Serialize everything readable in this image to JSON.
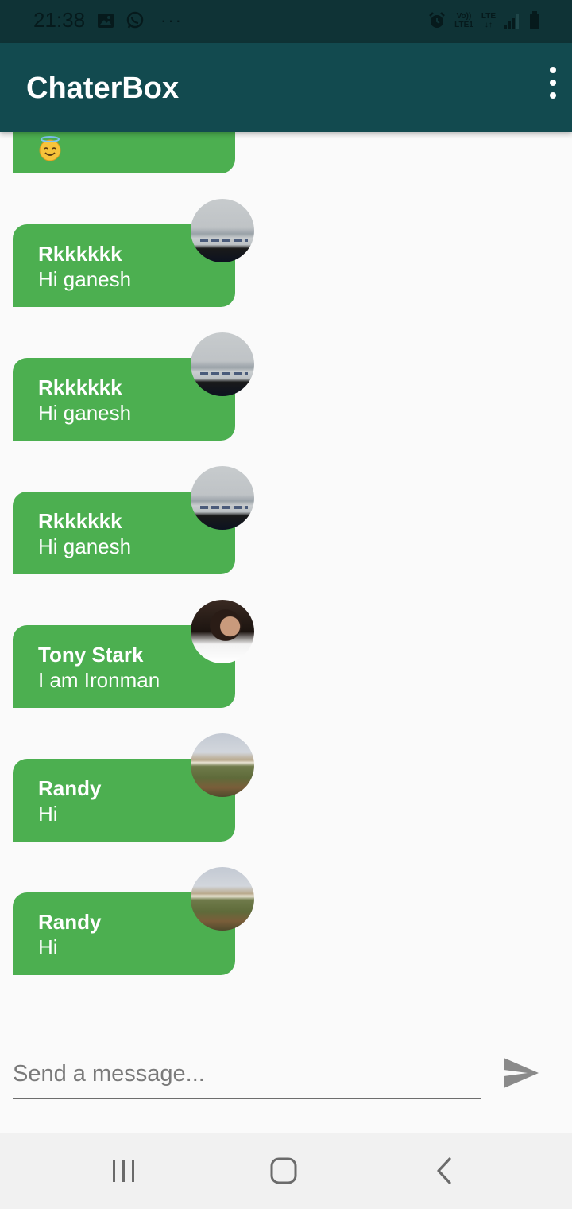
{
  "status_bar": {
    "time": "21:38",
    "left_icons": [
      "image-icon",
      "whatsapp-icon",
      "more-notifications-icon"
    ],
    "overflow_dots": "···",
    "right_icons": [
      "alarm-icon",
      "volte-lte-icon",
      "lte-data-icon",
      "signal-icon",
      "battery-icon"
    ],
    "lte_top": "Vo))",
    "lte_bottom": "LTE1",
    "lte2_top": "LTE",
    "lte2_bottom": "↓↑"
  },
  "app_bar": {
    "title": "ChaterBox",
    "overflow_icon": "more-vert-icon"
  },
  "messages": [
    {
      "sender": "Rkkkkkk",
      "text": "Hi ganesh",
      "avatar": "monitor-photo-avatar"
    },
    {
      "sender": "Rkkkkkk",
      "text": "Hi ganesh",
      "avatar": "monitor-photo-avatar"
    },
    {
      "sender": "Rkkkkkk",
      "text": "Hi ganesh",
      "avatar": "monitor-photo-avatar"
    },
    {
      "sender": "Tony Stark",
      "text": "I am Ironman",
      "avatar": "tony-stark-avatar"
    },
    {
      "sender": "Randy",
      "text": "Hi",
      "avatar": "field-photo-avatar"
    },
    {
      "sender": "Randy",
      "text": "Hi",
      "avatar": "field-photo-avatar"
    }
  ],
  "partial_message": {
    "emoji": "smiling-face-with-halo-icon"
  },
  "composer": {
    "placeholder": "Send a message...",
    "value": "",
    "send_icon": "send-icon"
  },
  "navigation": {
    "recents_icon": "recents-icon",
    "home_icon": "home-icon",
    "back_icon": "back-icon"
  },
  "colors": {
    "status_bar": "#0f3336",
    "app_bar": "#124a4f",
    "bubble": "#4caf50",
    "background": "#fafafa",
    "nav_bar": "#f1f1f1"
  }
}
